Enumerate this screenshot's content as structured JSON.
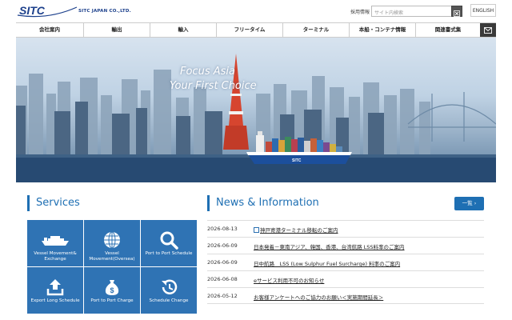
{
  "header": {
    "logo_text": "SITC",
    "company_name": "SITC JAPAN CO.,LTD.",
    "recruit_link": "採用情報",
    "search_placeholder": "サイト内検索",
    "language_button": "ENGLISH"
  },
  "nav": {
    "items": [
      {
        "label": "会社案内"
      },
      {
        "label": "輸出"
      },
      {
        "label": "輸入"
      },
      {
        "label": "フリータイム"
      },
      {
        "label": "ターミナル"
      },
      {
        "label": "本船・コンテナ情報"
      },
      {
        "label": "関連書式集"
      }
    ],
    "mail_icon": "mail-icon"
  },
  "hero": {
    "line1": "Focus Asia",
    "line2": "Your First Choice"
  },
  "services": {
    "title": "Services",
    "items": [
      {
        "label": "Vessel Movement& Exchange",
        "icon": "ship-icon"
      },
      {
        "label": "Vessel Movement(Oversea)",
        "icon": "globe-icon"
      },
      {
        "label": "Port to Port Schedule",
        "icon": "search-icon"
      },
      {
        "label": "Export Long Schedule",
        "icon": "export-icon"
      },
      {
        "label": "Port to Port Charge",
        "icon": "money-bag-icon"
      },
      {
        "label": "Schedule Change",
        "icon": "history-icon"
      }
    ]
  },
  "news": {
    "title": "News & Information",
    "more_button": "一覧",
    "items": [
      {
        "date": "2026-08-13",
        "text": "神戸寄港ターミナル移転のご案内",
        "external": true
      },
      {
        "date": "2026-06-09",
        "text": "日本発着－東南アジア、韓国、香港、台湾航路 LSS料率のご案内",
        "external": false
      },
      {
        "date": "2026-06-09",
        "text": "日中航路　LSS (Low Sulphur Fuel Surcharge) 料率のご案内",
        "external": false
      },
      {
        "date": "2026-06-08",
        "text": "eサービス利用不可のお知らせ",
        "external": false
      },
      {
        "date": "2026-05-12",
        "text": "お客様アンケートへのご協力のお願い＜実施期間延長＞",
        "external": false
      }
    ]
  },
  "colors": {
    "brand_blue": "#1e6fb3",
    "tile_blue": "#2f73b4",
    "nav_dark": "#3a3a3a"
  }
}
